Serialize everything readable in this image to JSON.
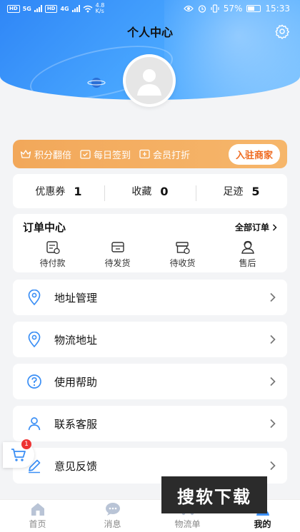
{
  "status_bar": {
    "left_badges": [
      "HD",
      "HD"
    ],
    "net_left": "5G",
    "net_right": "4G",
    "speed_value": "4.8",
    "speed_unit": "K/s",
    "battery": "57%",
    "time": "15:33"
  },
  "header": {
    "title": "个人中心",
    "settings_icon": "gear-icon"
  },
  "promo": {
    "items": [
      {
        "label": "积分翻倍",
        "icon": "crown-icon"
      },
      {
        "label": "每日签到",
        "icon": "calendar-check-icon"
      },
      {
        "label": "会员打折",
        "icon": "discount-card-icon"
      }
    ],
    "join_label": "入驻商家",
    "colors": {
      "bg": "#f2a85a",
      "join_text": "#ef6a1f"
    }
  },
  "stats": [
    {
      "label": "优惠券",
      "value": "1"
    },
    {
      "label": "收藏",
      "value": "0"
    },
    {
      "label": "足迹",
      "value": "5"
    }
  ],
  "orders": {
    "title": "订单中心",
    "all_label": "全部订单",
    "items": [
      {
        "label": "待付款",
        "icon": "pending-payment-icon"
      },
      {
        "label": "待发货",
        "icon": "pending-shipment-icon"
      },
      {
        "label": "待收货",
        "icon": "pending-receipt-icon"
      },
      {
        "label": "售后",
        "icon": "after-sales-icon"
      }
    ]
  },
  "menu": [
    {
      "label": "地址管理",
      "icon": "location-pin-icon"
    },
    {
      "label": "物流地址",
      "icon": "location-pin-icon"
    },
    {
      "label": "使用帮助",
      "icon": "help-circle-icon"
    },
    {
      "label": "联系客服",
      "icon": "person-icon"
    },
    {
      "label": "意见反馈",
      "icon": "pencil-icon"
    }
  ],
  "cart_badge": "1",
  "tabbar": [
    {
      "label": "首页",
      "icon": "home-icon"
    },
    {
      "label": "消息",
      "icon": "chat-icon"
    },
    {
      "label": "物流单",
      "icon": "truck-icon"
    },
    {
      "label": "我的",
      "icon": "profile-icon",
      "active": true
    }
  ],
  "watermark": "搜软下载",
  "accent_color": "#3b8ff5"
}
